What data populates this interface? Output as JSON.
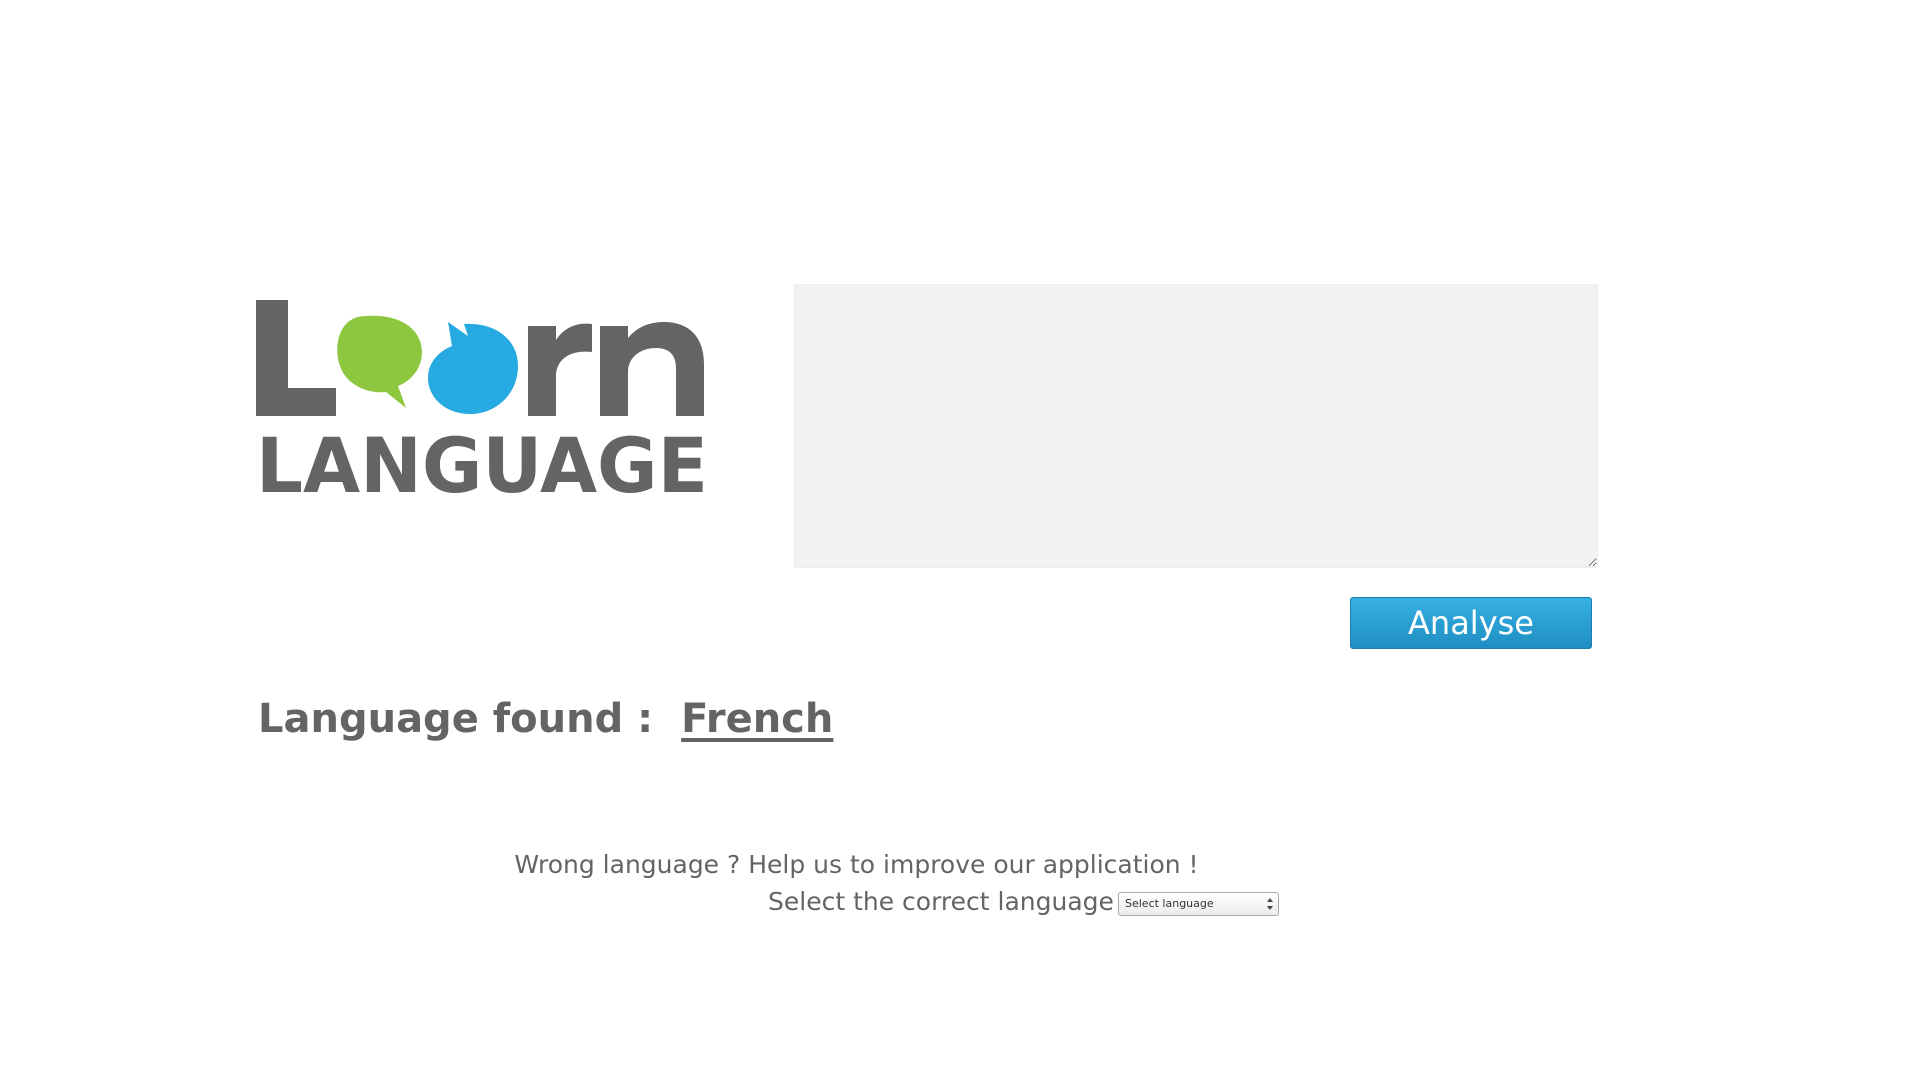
{
  "logo": {
    "word_top": "Learn",
    "word_bottom": "LANGUAGE",
    "colors": {
      "text": "#636466",
      "bubble_green": "#8dc63f",
      "bubble_blue": "#27aae1"
    }
  },
  "input": {
    "value": "",
    "placeholder": ""
  },
  "analyse_button": {
    "label": "Analyse",
    "color": "#2a9fd3"
  },
  "result": {
    "label": "Language found :",
    "language": "French"
  },
  "feedback": {
    "line1": "Wrong language ? Help us to improve our application !",
    "line2": "Select the correct language :",
    "select_value": "Select language"
  },
  "colors": {
    "text_gray": "#636466",
    "input_bg": "#f2f2f2"
  }
}
